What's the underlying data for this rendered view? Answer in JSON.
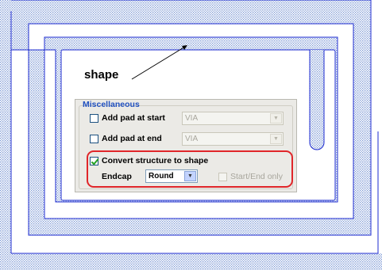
{
  "annotation": {
    "label": "shape"
  },
  "group": {
    "title": "Miscellaneous"
  },
  "options": {
    "pad_start": {
      "label": "Add pad at start",
      "checked": false,
      "dropdown_value": "VIA"
    },
    "pad_end": {
      "label": "Add pad at end",
      "checked": false,
      "dropdown_value": "VIA"
    },
    "convert": {
      "label": "Convert structure to shape",
      "checked": true
    },
    "endcap": {
      "label": "Endcap",
      "dropdown_value": "Round"
    },
    "start_end_only": {
      "label": "Start/End only",
      "checked": false,
      "enabled": false
    }
  },
  "colors": {
    "trace_fill": "#9fb8de",
    "trace_outline": "#1e2bd0",
    "highlight": "#e0262a",
    "group_title": "#2050c0"
  },
  "icons": {
    "dropdown": "chevron-down-icon",
    "checkmark": "check-icon",
    "arrow": "arrow-icon"
  }
}
